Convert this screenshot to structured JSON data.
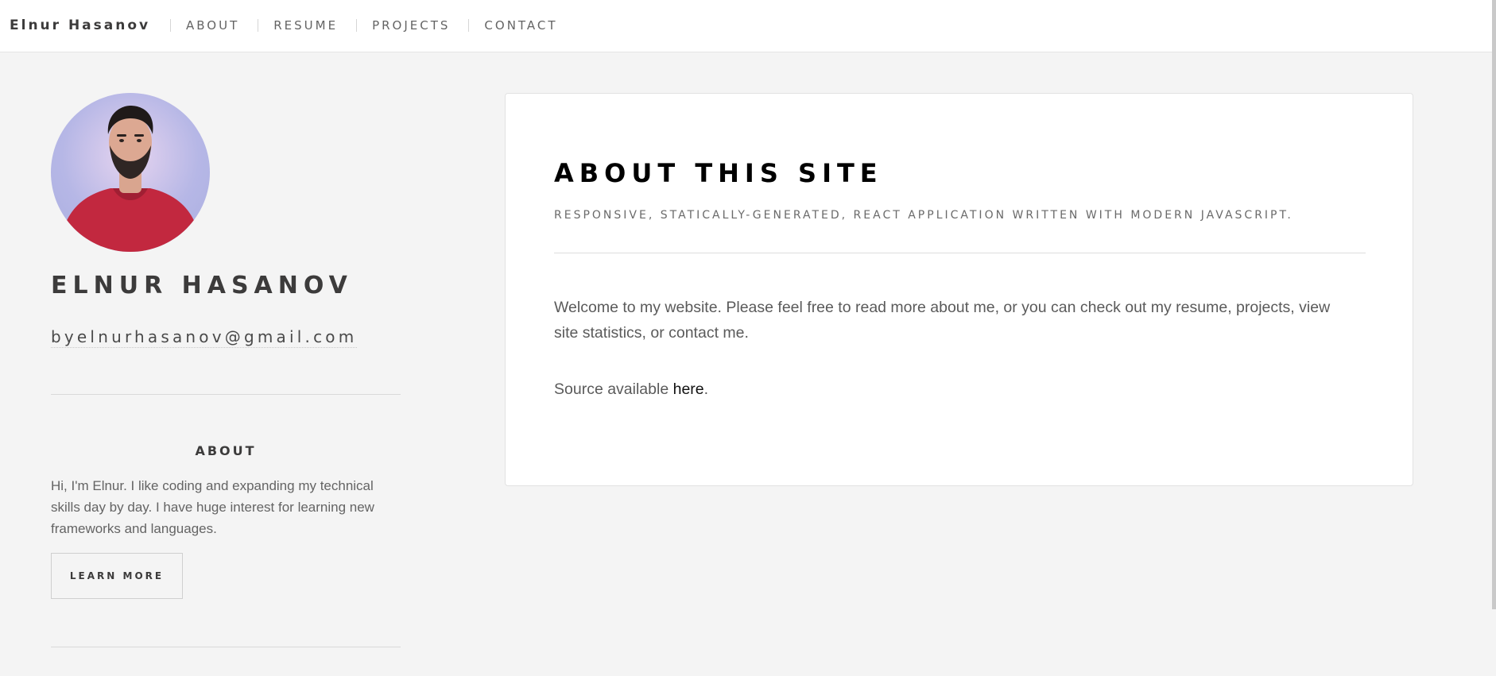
{
  "header": {
    "brand": "Elnur Hasanov",
    "nav": [
      "ABOUT",
      "RESUME",
      "PROJECTS",
      "CONTACT"
    ]
  },
  "sidebar": {
    "name": "ELNUR HASANOV",
    "email": "byelnurhasanov@gmail.com",
    "about_title": "ABOUT",
    "about_text": "Hi, I'm Elnur. I like coding and expanding my technical skills day by day. I have huge interest for learning new frameworks and languages.",
    "learn_more": "LEARN MORE"
  },
  "main": {
    "title": "ABOUT THIS SITE",
    "subtitle": "RESPONSIVE, STATICALLY-GENERATED, REACT APPLICATION WRITTEN WITH MODERN JAVASCRIPT.",
    "welcome": "Welcome to my website. Please feel free to read more about me, or you can check out my resume, projects, view site statistics, or contact me.",
    "source_prefix": "Source available ",
    "source_link": "here",
    "source_suffix": "."
  },
  "colors": {
    "background": "#f4f4f4",
    "card": "#ffffff",
    "heading": "#3c3b3b",
    "text": "#646464",
    "sweater": "#c2283f"
  },
  "icons": {
    "avatar": "profile-photo"
  }
}
